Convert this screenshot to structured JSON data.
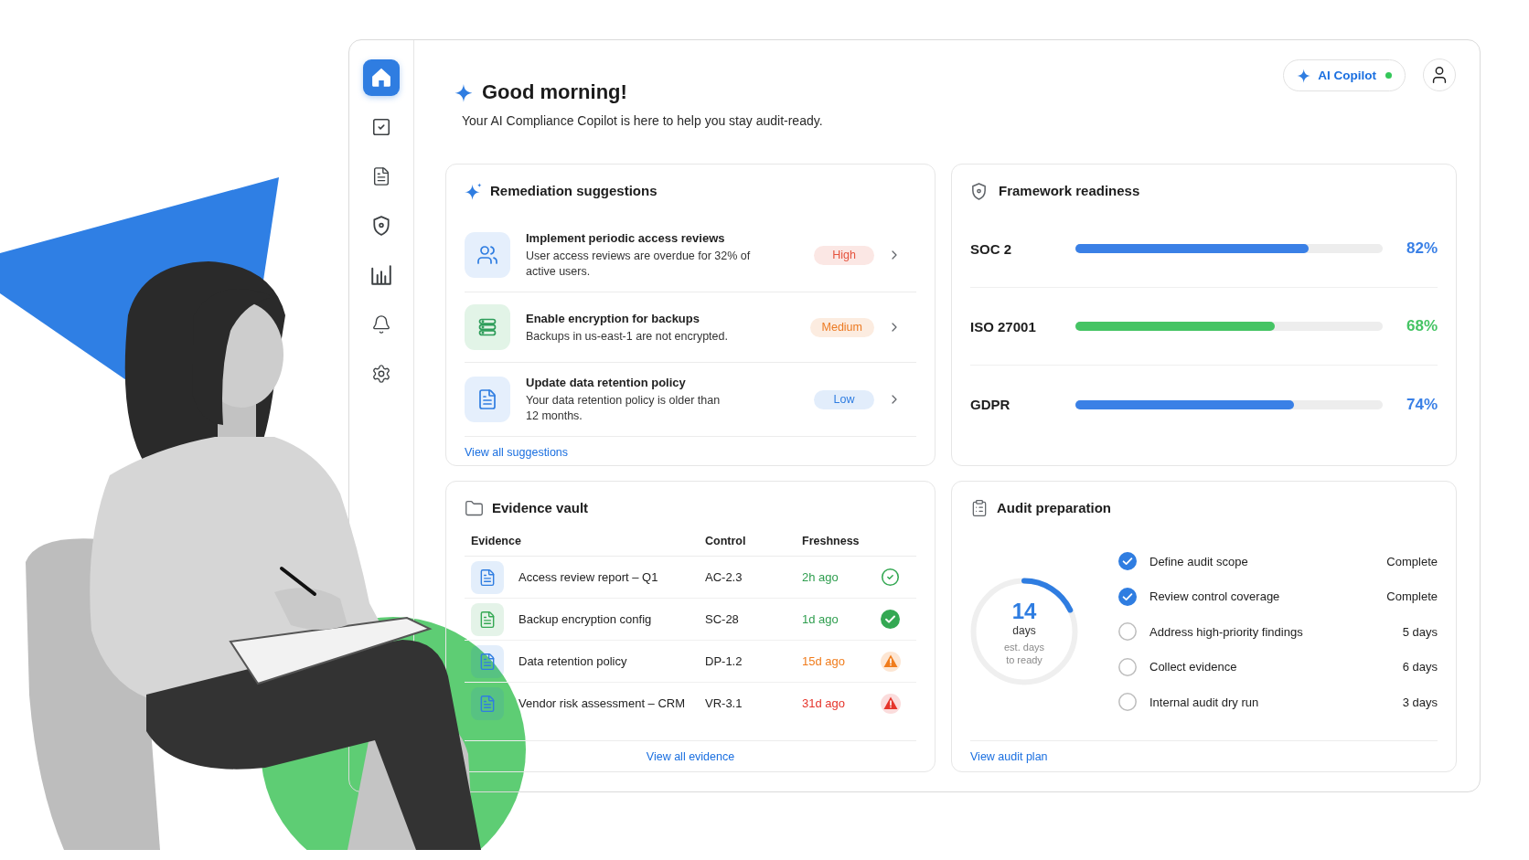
{
  "sidebar": {
    "items": [
      {
        "kind": "home",
        "selected": true
      },
      {
        "kind": "tasks",
        "selected": false
      },
      {
        "kind": "document",
        "selected": false
      },
      {
        "kind": "shield",
        "selected": false
      },
      {
        "kind": "chart",
        "selected": false
      },
      {
        "kind": "bell",
        "selected": false
      },
      {
        "kind": "settings",
        "selected": false
      }
    ]
  },
  "header": {
    "greeting": "Good morning!",
    "subtitle": "Your AI Compliance Copilot is here to help you stay audit-ready.",
    "copilot": {
      "label": "AI Copilot",
      "online": true
    }
  },
  "remediation": {
    "title": "Remediation suggestions",
    "items": [
      {
        "kind": "users",
        "title": "Implement periodic access reviews",
        "description": "User access reviews are overdue for 32% of\nactive users.",
        "priority": "High",
        "color": "#e5533d"
      },
      {
        "kind": "storage",
        "title": "Enable encryption for backups",
        "description": "Backups in us-east-1 are not encrypted.",
        "priority": "Medium",
        "color": "#ec7a22"
      },
      {
        "kind": "document",
        "title": "Update data retention policy",
        "description": "Your data retention policy is older than\n12 months.",
        "priority": "Low",
        "color": "#2f7de1"
      }
    ],
    "link": "View all suggestions"
  },
  "frameworks": {
    "title": "Framework readiness",
    "items": [
      {
        "name": "SOC 2",
        "level": 0.76,
        "reading": "82%",
        "color": "#3a80e6"
      },
      {
        "name": "ISO 27001",
        "level": 0.65,
        "reading": "68%",
        "color": "#45c464"
      },
      {
        "name": "GDPR",
        "level": 0.71,
        "reading": "74%",
        "color": "#3a80e6"
      }
    ]
  },
  "evidence": {
    "title": "Evidence vault",
    "columns": [
      "Evidence",
      "Control",
      "Freshness"
    ],
    "rows": [
      {
        "name": "Access review report – Q1",
        "control": "AC-2.3",
        "freshness": "2h ago",
        "color": "#2f7de1",
        "kind": "ok"
      },
      {
        "name": "Backup encryption config",
        "control": "SC-28",
        "freshness": "1d ago",
        "color": "#34a853",
        "kind": "verified"
      },
      {
        "name": "Data retention policy",
        "control": "DP-1.2",
        "freshness": "15d ago",
        "color": "#2f7de1",
        "kind": "warning"
      },
      {
        "name": "Vendor risk assessment – CRM",
        "control": "VR-3.1",
        "freshness": "31d ago",
        "color": "#2f7de1",
        "kind": "critical"
      }
    ],
    "link": "View all evidence"
  },
  "audit": {
    "title": "Audit preparation",
    "countdown": {
      "value": "14",
      "unit": "days",
      "caption": "est. days to ready",
      "level": 0.18
    },
    "steps": [
      {
        "label": "Define audit scope",
        "checked": true,
        "due": "Complete"
      },
      {
        "label": "Review control coverage",
        "checked": true,
        "due": "Complete"
      },
      {
        "label": "Address high-priority findings",
        "checked": false,
        "due": "5 days"
      },
      {
        "label": "Collect evidence",
        "checked": false,
        "due": "6 days"
      },
      {
        "label": "Internal audit dry run",
        "checked": false,
        "due": "3 days"
      }
    ],
    "link": "View audit plan"
  }
}
